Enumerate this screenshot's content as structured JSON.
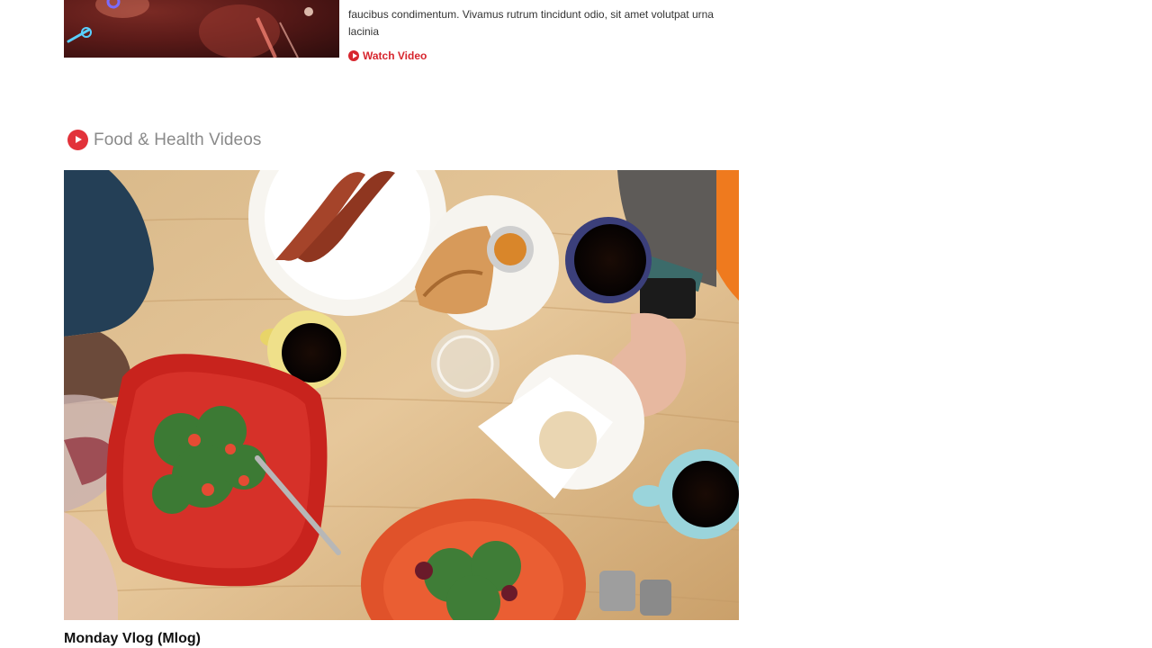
{
  "previous_video": {
    "description_line1": "faucibus condimentum. Vivamus rutrum tincidunt odio, sit amet volutpat urna",
    "description_line2": "lacinia",
    "watch_label": "Watch Video"
  },
  "section": {
    "title": "Food & Health Videos",
    "icon": "play-circle-icon"
  },
  "video": {
    "title": "Monday Vlog (Mlog)"
  },
  "colors": {
    "accent": "#d7262e",
    "section_title": "#8a8a8a"
  }
}
